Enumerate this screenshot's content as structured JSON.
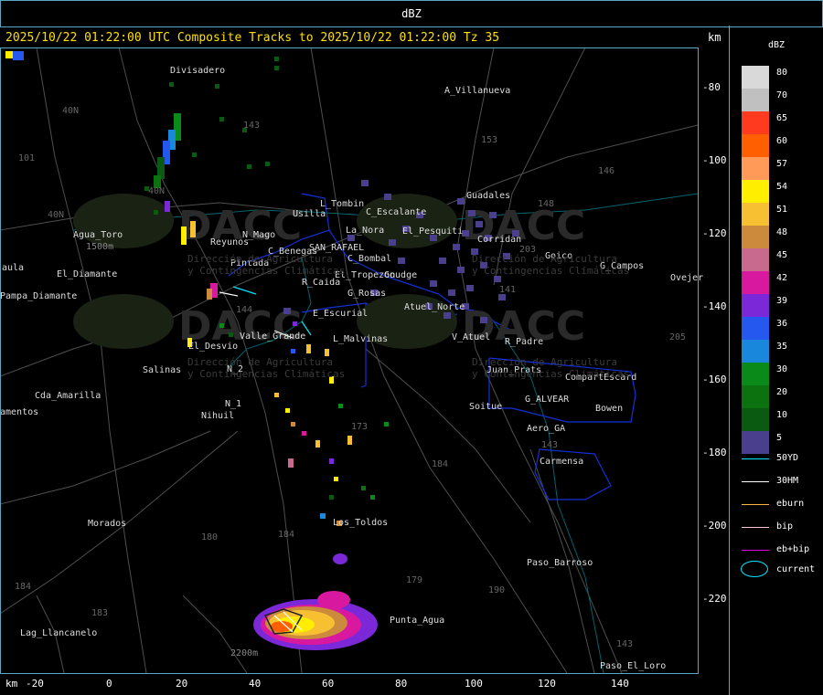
{
  "window": {
    "title": "dBZ"
  },
  "header": {
    "text": "2025/10/22 01:22:00 UTC Composite Tracks to 2025/10/22 01:22:00 Tz 35",
    "km_label": "km"
  },
  "legend": {
    "title": "dBZ",
    "levels": [
      {
        "value": "80",
        "color": "#d9d9d9"
      },
      {
        "value": "70",
        "color": "#c0c0c0"
      },
      {
        "value": "65",
        "color": "#ff3a1f"
      },
      {
        "value": "60",
        "color": "#ff5f00"
      },
      {
        "value": "57",
        "color": "#ff9a58"
      },
      {
        "value": "54",
        "color": "#ffee00"
      },
      {
        "value": "51",
        "color": "#f6c032"
      },
      {
        "value": "48",
        "color": "#cc8a3c"
      },
      {
        "value": "45",
        "color": "#c86a8e"
      },
      {
        "value": "42",
        "color": "#d819a0"
      },
      {
        "value": "39",
        "color": "#7a28d8"
      },
      {
        "value": "36",
        "color": "#2458ee"
      },
      {
        "value": "35",
        "color": "#1887dc"
      },
      {
        "value": "30",
        "color": "#0a8a18"
      },
      {
        "value": "20",
        "color": "#0c7210"
      },
      {
        "value": "10",
        "color": "#0a5a12"
      },
      {
        "value": "5",
        "color": "#4a3f8c"
      }
    ],
    "tracks": [
      {
        "label": "50YD",
        "color": "#00e5ff"
      },
      {
        "label": "30HM",
        "color": "#ffffff"
      },
      {
        "label": "eburn",
        "color": "#ffb347"
      },
      {
        "label": "bip",
        "color": "#ffc4d8"
      },
      {
        "label": "eb+bip",
        "color": "#e000e0"
      }
    ],
    "current_label": "current",
    "current_color": "#00e5ff"
  },
  "axes": {
    "x_unit": "km",
    "y_unit": "km",
    "x_ticks": [
      "-20",
      "0",
      "20",
      "40",
      "60",
      "80",
      "100",
      "120",
      "140"
    ],
    "y_ticks": [
      "-80",
      "-100",
      "-120",
      "-140",
      "-160",
      "-180",
      "-200",
      "-220"
    ]
  },
  "places": [
    "Divisadero",
    "A_Villanueva",
    "Guadales",
    "Usilla",
    "L_Tombin",
    "C_Escalante",
    "La_Nora",
    "El_Pesquiti",
    "Agua_Toro",
    "Reyunos",
    "N_Mago",
    "C_Benegas",
    "SAN_RAFAEL",
    "C_Bombal",
    "Pintada",
    "R_Caida",
    "El_Tropezon",
    "Goudge",
    "Corridan",
    "Goico",
    "G_Campos",
    "Ovejer",
    "Pampa_Diamante",
    "G_Rosas",
    "Atuel_Norte",
    "E_Escurial",
    "Valle_Grande",
    "L_Malvinas",
    "V_Atuel",
    "R_Padre",
    "El_Desvio",
    "Salinas",
    "Juan_Prats",
    "CompartEscard",
    "Cda_Amarilla",
    "N_1",
    "N_2",
    "Nihuil",
    "Soitue",
    "G_ALVEAR",
    "Bowen",
    "Aero_GA",
    "Carmensa",
    "Morados",
    "Los_Toldos",
    "Paso_Barroso",
    "Punta_Agua",
    "Lag_Llancanelo",
    "Paso_El_Loro",
    "aula",
    "amentos",
    "El_Diamante"
  ],
  "route_numbers": [
    "101",
    "153",
    "143",
    "146",
    "148",
    "203",
    "205",
    "40N",
    "40N",
    "144",
    "173",
    "184",
    "180",
    "184",
    "179",
    "190",
    "143",
    "183",
    "184",
    "143",
    "141",
    "40N"
  ],
  "watermark": {
    "brand": "DACC",
    "lines": [
      "Dirección de Agricultura",
      "y Contingencias Climáticas"
    ]
  },
  "annotations": {
    "elevation_1": "1500m",
    "elevation_2": "2200m"
  }
}
